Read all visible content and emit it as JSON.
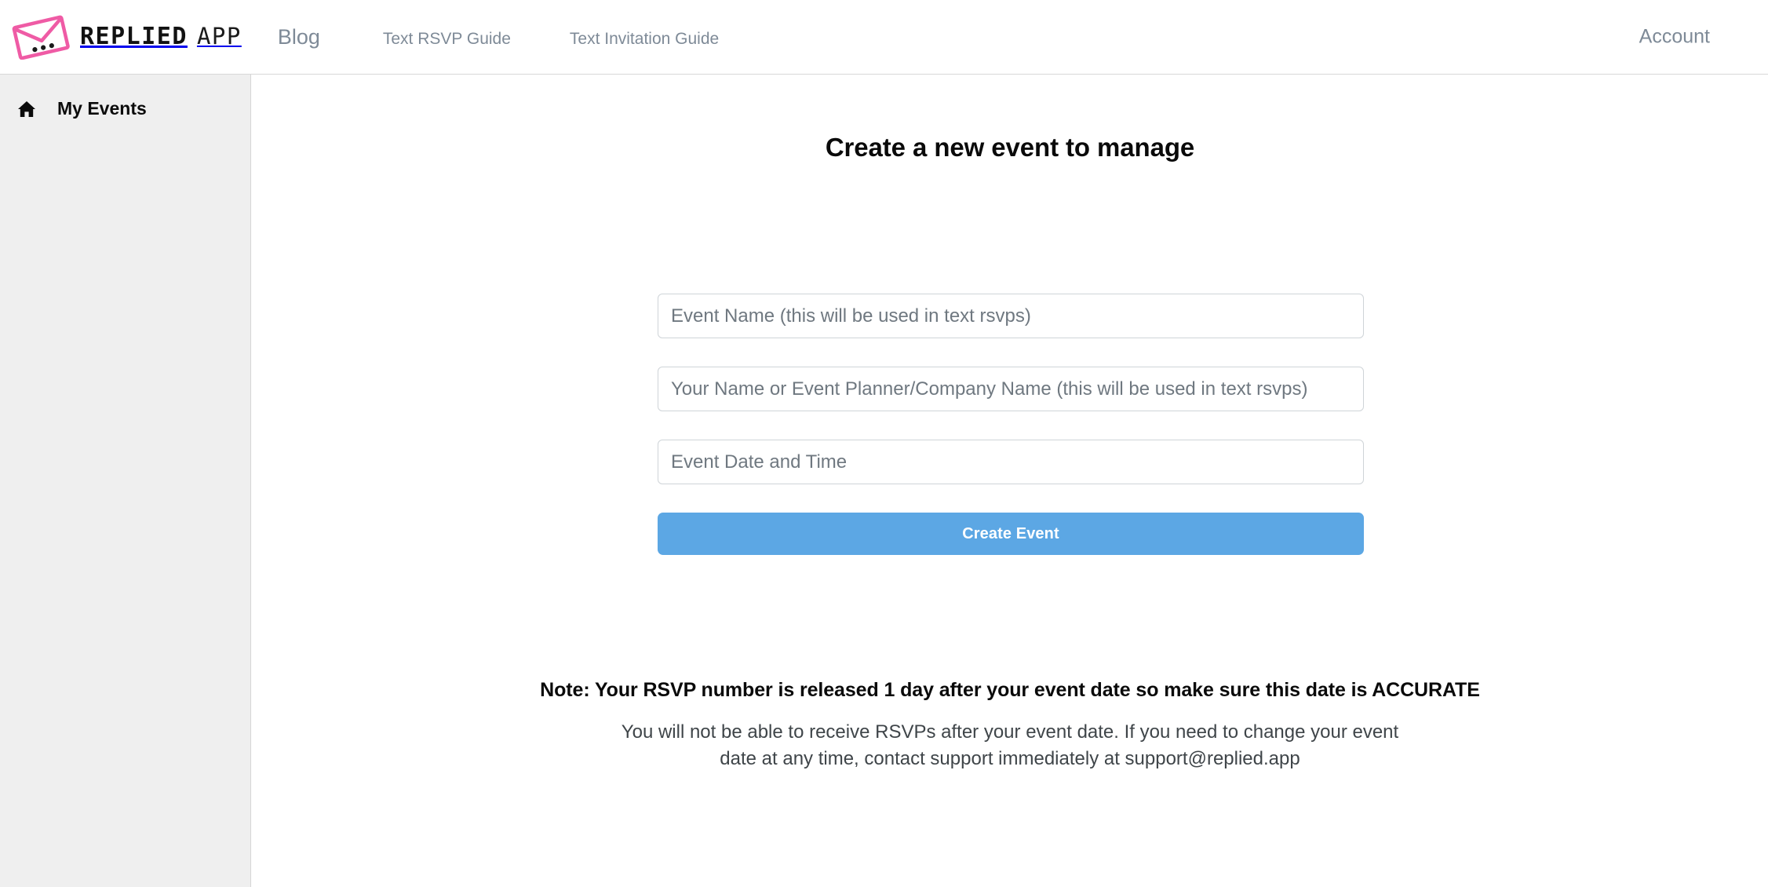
{
  "header": {
    "logo": {
      "icon": "envelope-logo-icon",
      "wordmark_bold": "REPLIED",
      "wordmark_light": "APP",
      "color": "#ef5ba5"
    },
    "nav": [
      {
        "label": "Blog",
        "name": "nav-link-blog",
        "size": "primary"
      },
      {
        "label": "Text RSVP Guide",
        "name": "nav-link-text-rsvp-guide",
        "size": "secondary"
      },
      {
        "label": "Text Invitation Guide",
        "name": "nav-link-text-invitation-guide",
        "size": "secondary"
      }
    ],
    "account_label": "Account"
  },
  "sidebar": {
    "items": [
      {
        "label": "My Events",
        "icon": "home-icon"
      }
    ]
  },
  "main": {
    "title": "Create a new event to manage",
    "form": {
      "event_name": {
        "placeholder": "Event Name (this will be used in text rsvps)",
        "value": ""
      },
      "planner_name": {
        "placeholder": "Your Name or Event Planner/Company Name (this will be used in text rsvps)",
        "value": ""
      },
      "event_datetime": {
        "placeholder": "Event Date and Time",
        "value": ""
      },
      "submit_label": "Create Event",
      "submit_color": "#5ca7e4"
    },
    "notice": {
      "headline": "Note: Your RSVP number is released 1 day after your event date so make sure this date is ACCURATE",
      "body": "You will not be able to receive RSVPs after your event date. If you need to change your event date at any time, contact support immediately at support@replied.app"
    }
  }
}
